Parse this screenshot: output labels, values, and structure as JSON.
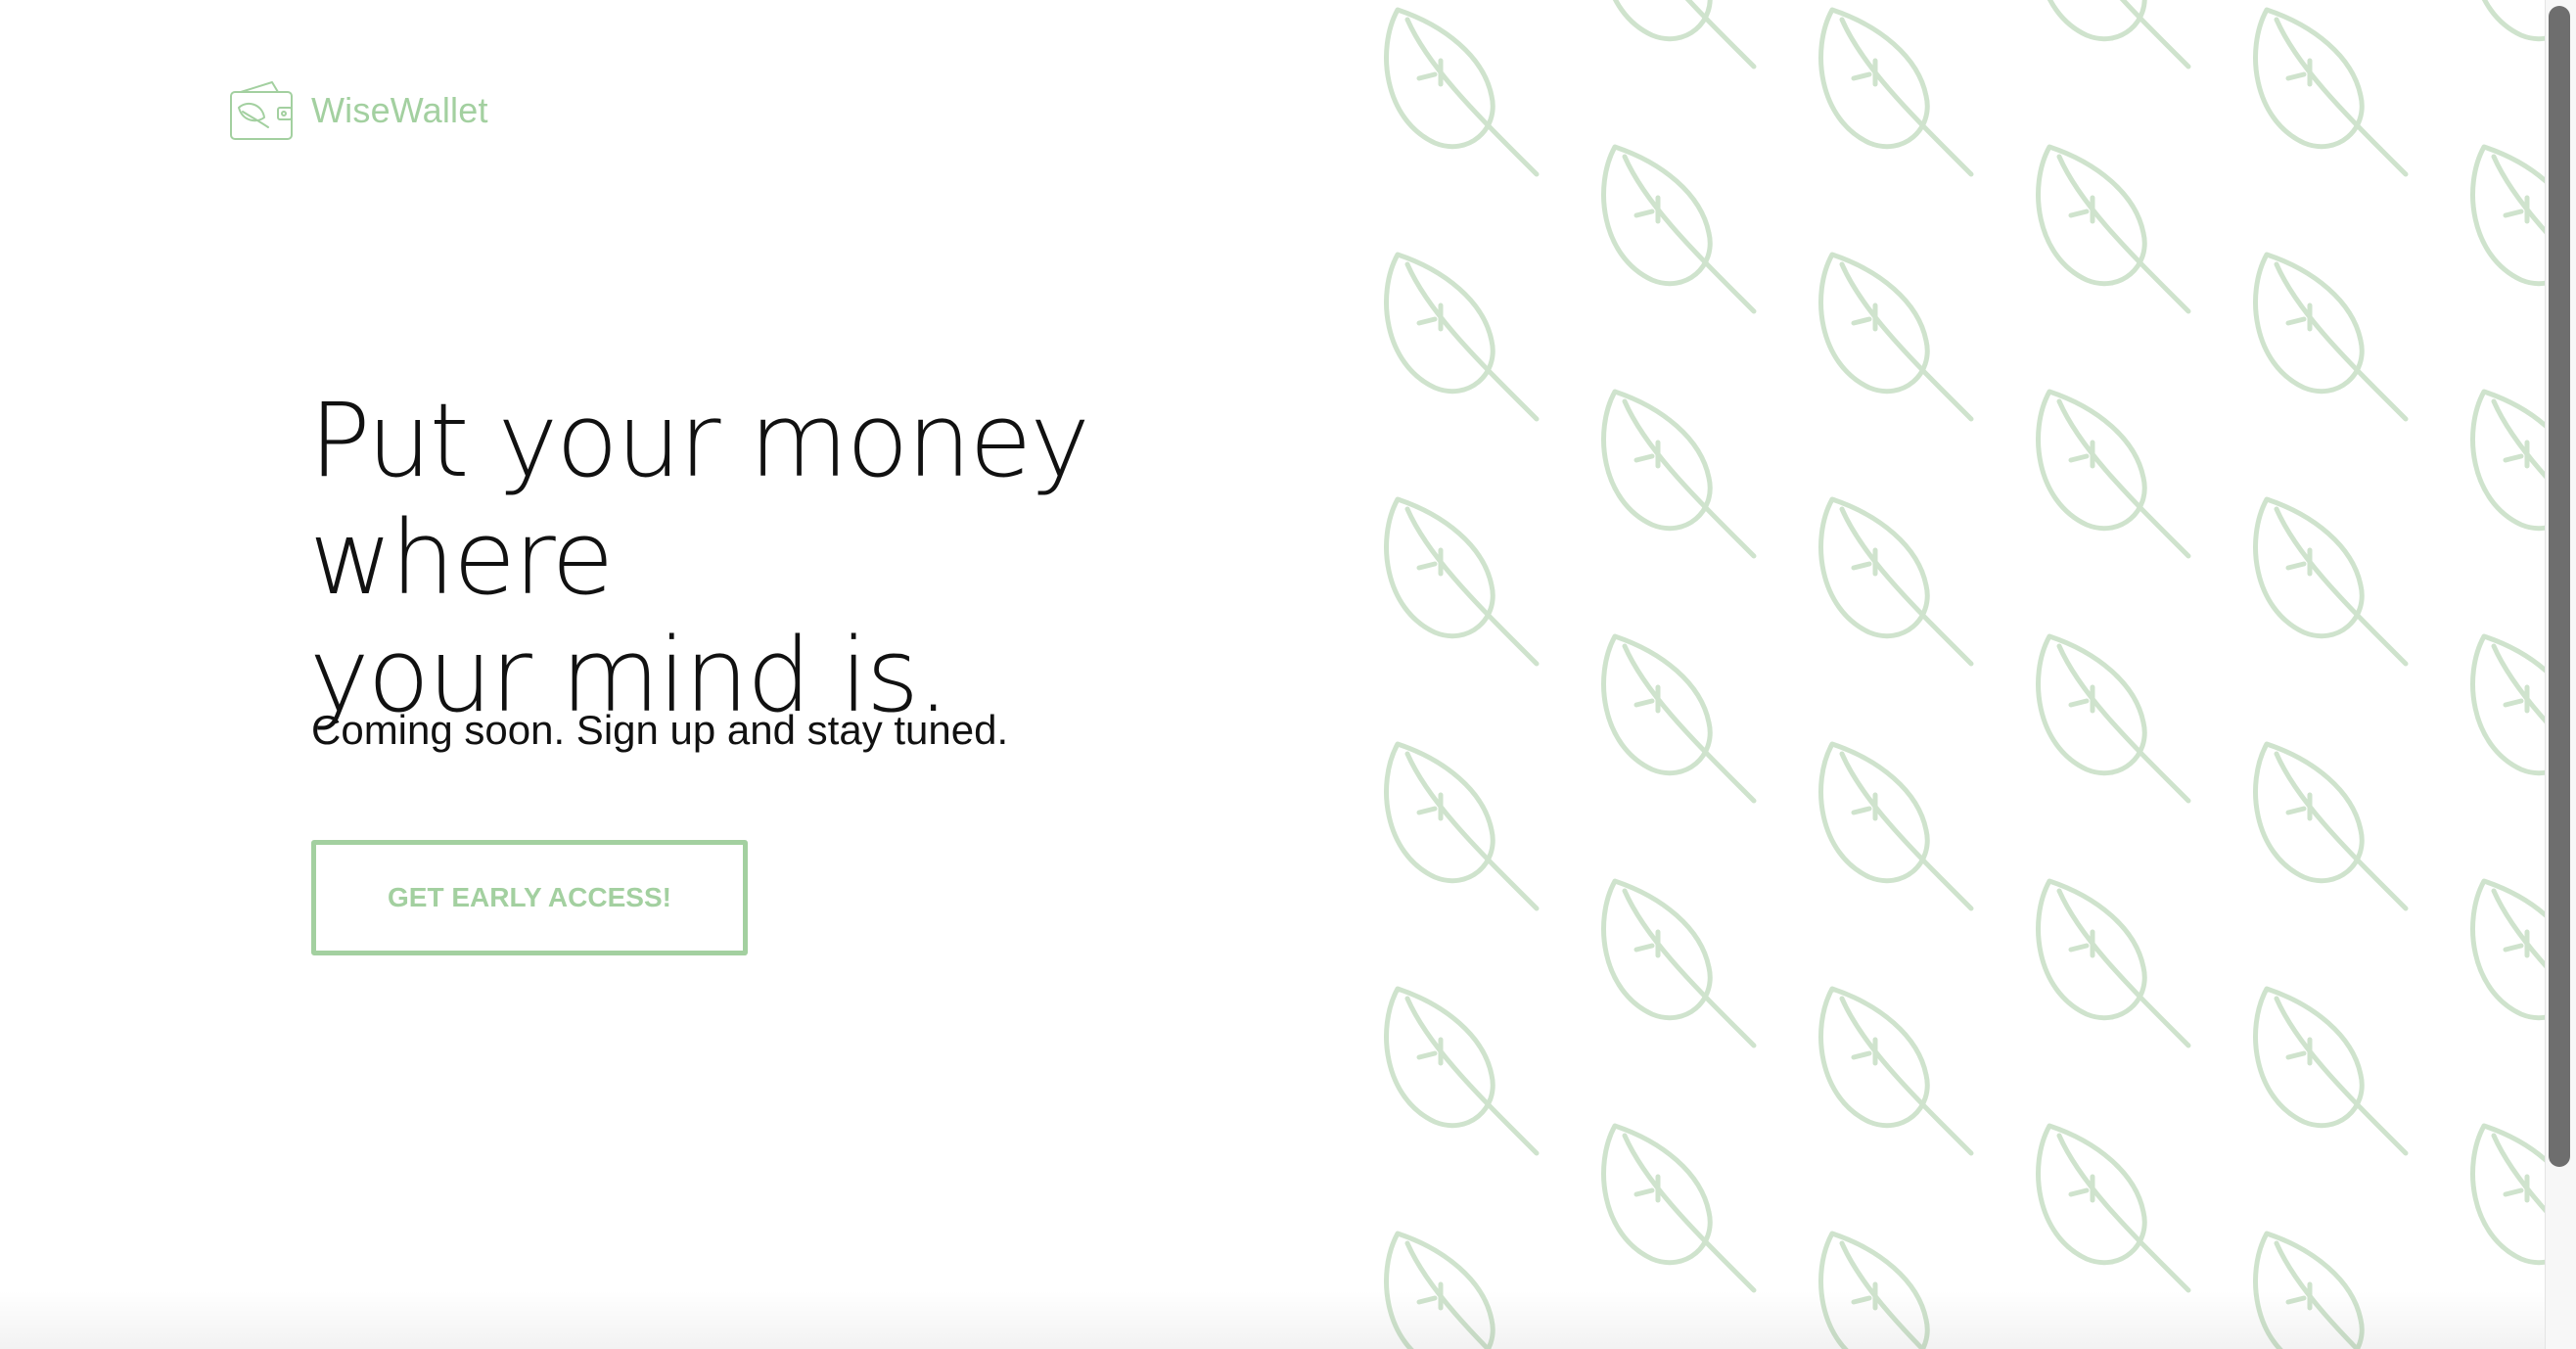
{
  "brand": {
    "name": "WiseWallet",
    "logo_icon": "wallet-leaf-icon",
    "color": "#a3d0a0"
  },
  "hero": {
    "headline_line1": "Put your money where",
    "headline_line2": "your mind is.",
    "subtitle": "Coming soon. Sign up and stay tuned.",
    "cta_label": "GET EARLY ACCESS!"
  },
  "pattern": {
    "icon": "leaf-icon",
    "color": "#cfe3cd"
  },
  "colors": {
    "accent": "#a3d0a0",
    "text": "#111111",
    "background": "#ffffff"
  }
}
